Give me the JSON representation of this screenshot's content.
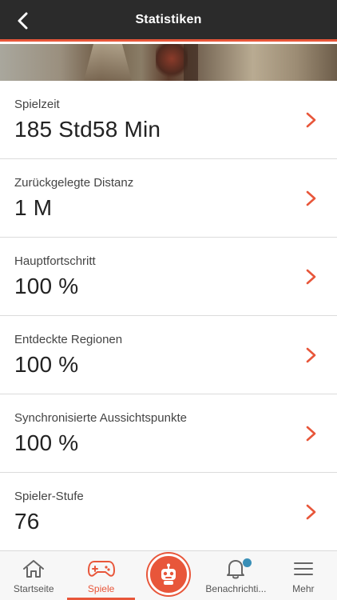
{
  "header": {
    "title": "Statistiken",
    "back_icon": "chevron-left-icon"
  },
  "stats": [
    {
      "label": "Spielzeit",
      "value": "185 Std58 Min"
    },
    {
      "label": "Zurückgelegte Distanz",
      "value": "1 M"
    },
    {
      "label": "Hauptfortschritt",
      "value": "100 %"
    },
    {
      "label": "Entdeckte Regionen",
      "value": "100 %"
    },
    {
      "label": "Synchronisierte Aussichtspunkte",
      "value": "100 %"
    },
    {
      "label": "Spieler-Stufe",
      "value": "76"
    }
  ],
  "tabs": [
    {
      "label": "Startseite",
      "icon": "home-icon"
    },
    {
      "label": "Spiele",
      "icon": "gamepad-icon",
      "active": true
    },
    {
      "label": "",
      "icon": "robot-icon"
    },
    {
      "label": "Benachrichti...",
      "icon": "bell-icon",
      "has_badge": true
    },
    {
      "label": "Mehr",
      "icon": "menu-icon"
    }
  ],
  "colors": {
    "accent": "#e8563a",
    "header_bg": "#2b2b2b",
    "badge": "#3a8fb7"
  }
}
